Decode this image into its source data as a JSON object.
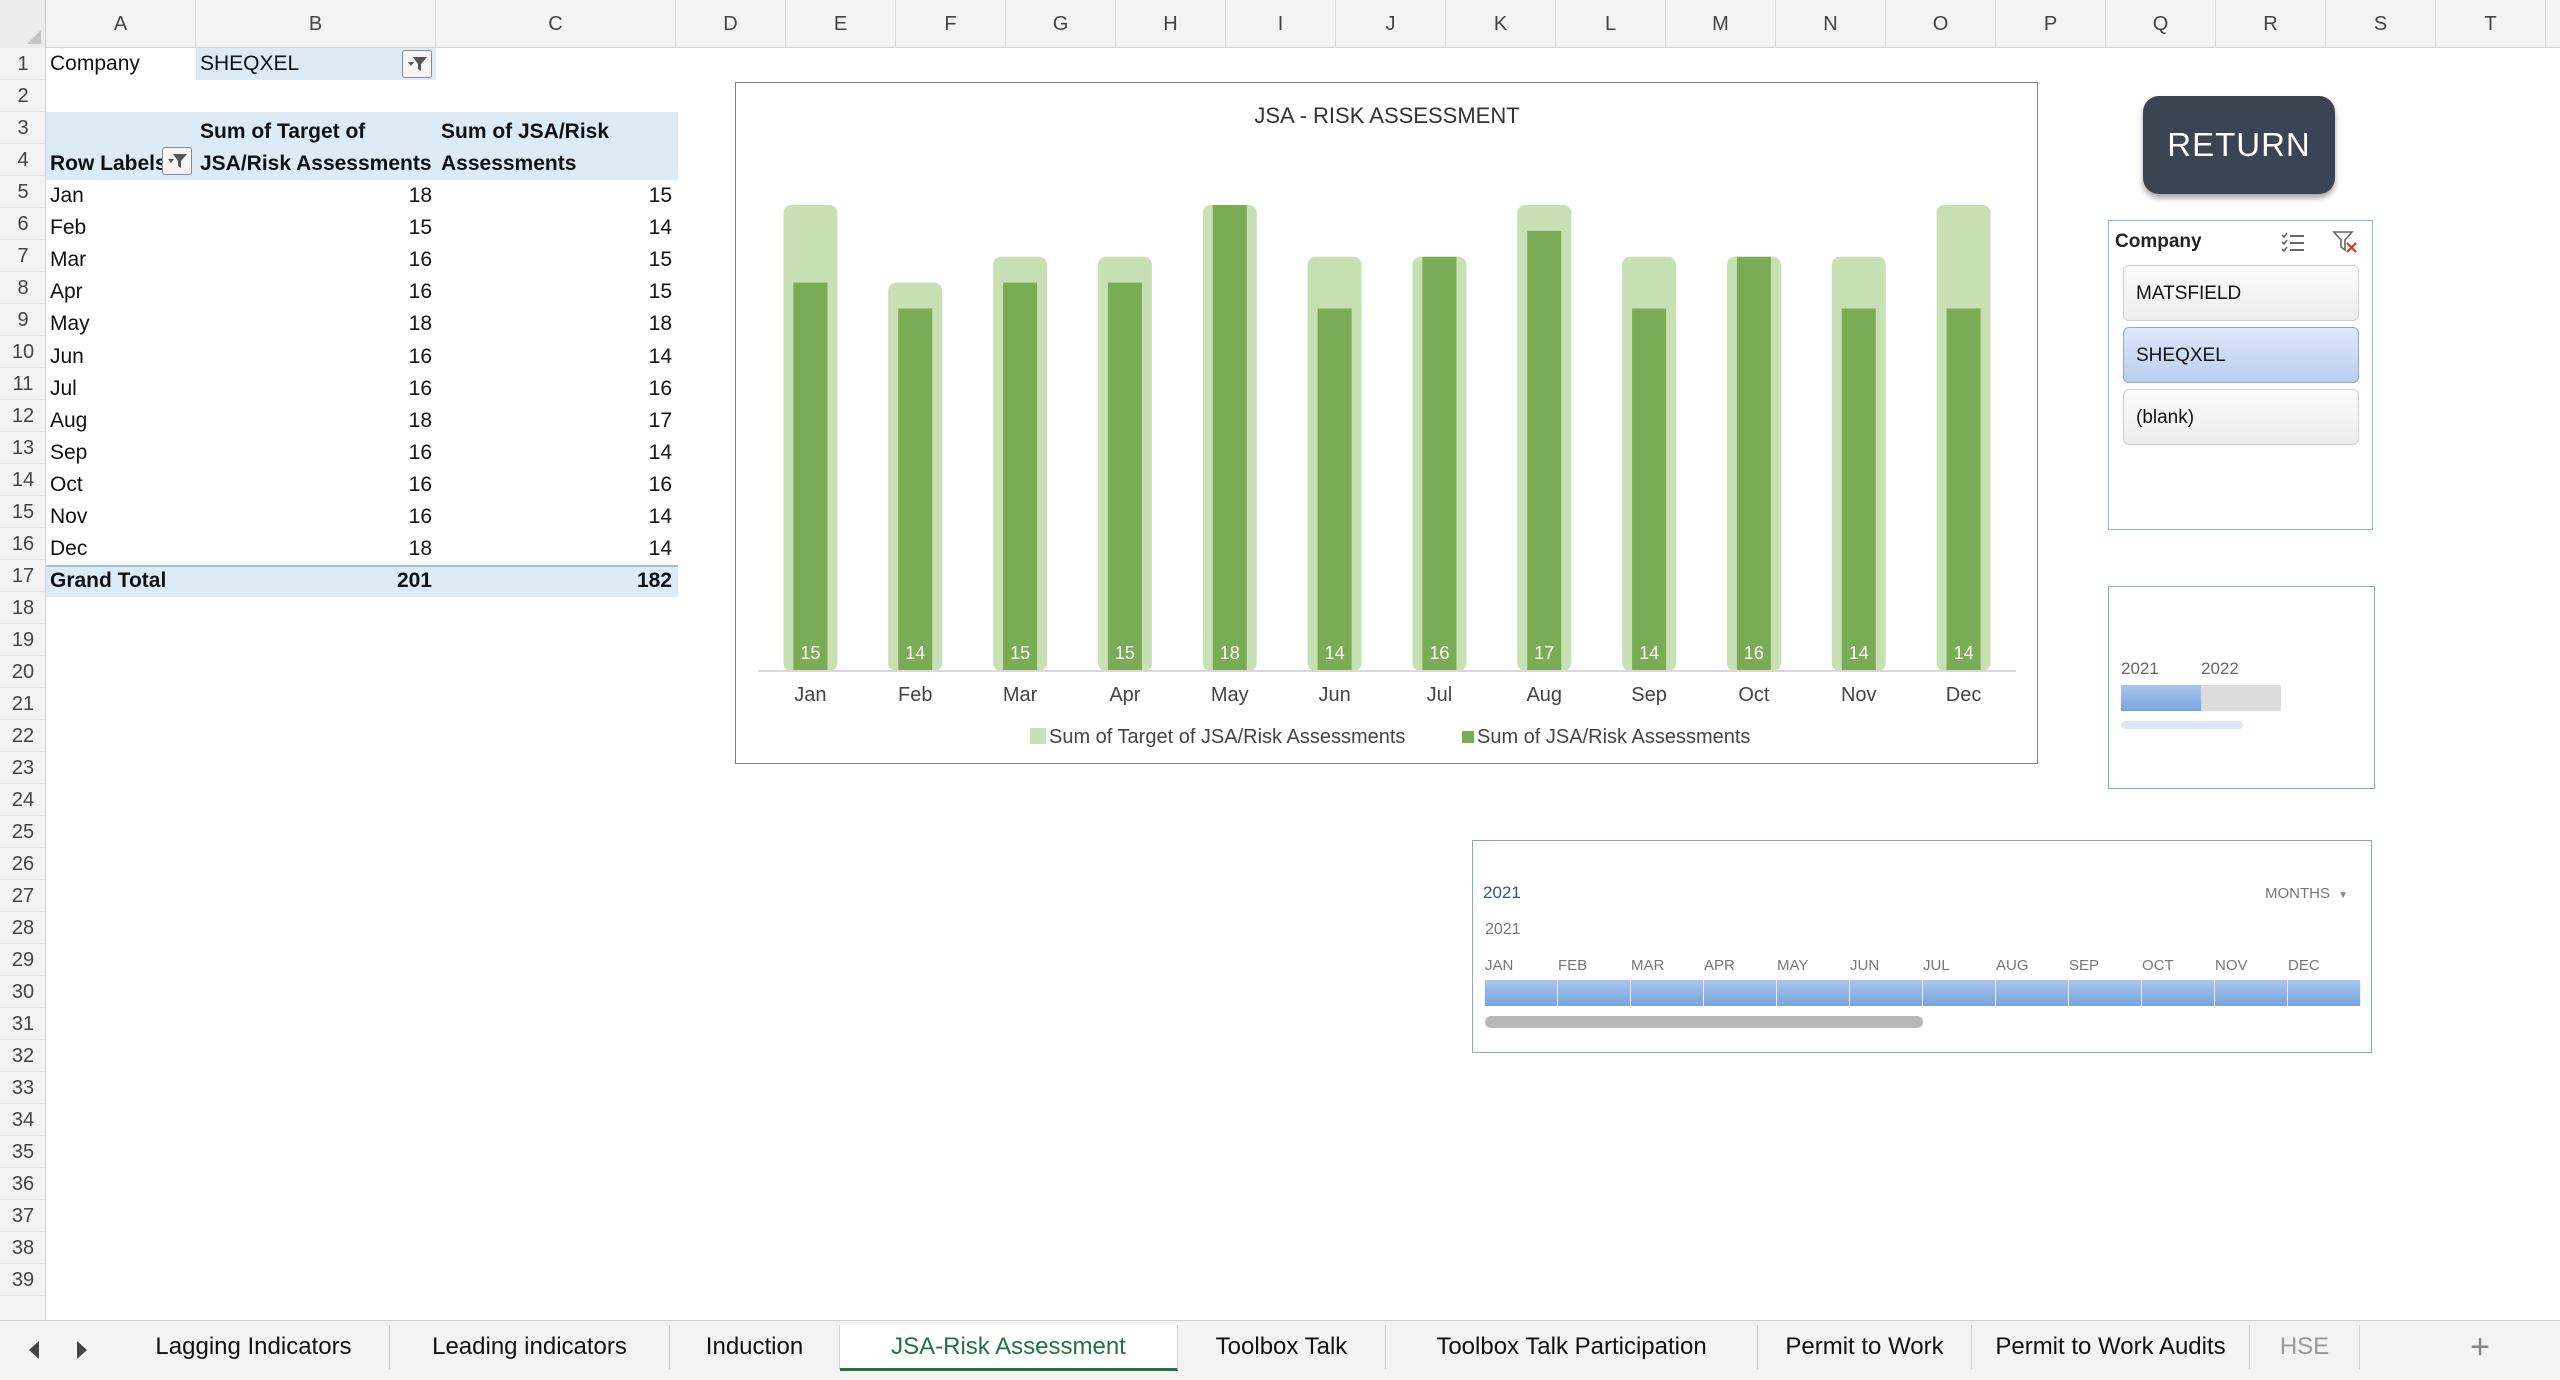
{
  "columns": [
    "A",
    "B",
    "C",
    "D",
    "E",
    "F",
    "G",
    "H",
    "I",
    "J",
    "K",
    "L",
    "M",
    "N",
    "O",
    "P",
    "Q",
    "R",
    "S",
    "T"
  ],
  "rows": [
    "1",
    "2",
    "3",
    "4",
    "5",
    "6",
    "7",
    "8",
    "9",
    "10",
    "11",
    "12",
    "13",
    "14",
    "15",
    "16",
    "17",
    "18",
    "19",
    "20",
    "21",
    "22",
    "23",
    "24",
    "25",
    "26",
    "27",
    "28",
    "29",
    "30",
    "31",
    "32",
    "33",
    "34",
    "35",
    "36",
    "37",
    "38",
    "39"
  ],
  "pivot": {
    "filter_label": "Company",
    "filter_value": "SHEQXEL",
    "row_labels_header": "Row Labels",
    "col_b_header_line1": "Sum of Target of",
    "col_b_header_line2": "JSA/Risk Assessments",
    "col_c_header_line1": "Sum of JSA/Risk",
    "col_c_header_line2": "Assessments",
    "rows": [
      {
        "label": "Jan",
        "target": "18",
        "actual": "15"
      },
      {
        "label": "Feb",
        "target": "15",
        "actual": "14"
      },
      {
        "label": "Mar",
        "target": "16",
        "actual": "15"
      },
      {
        "label": "Apr",
        "target": "16",
        "actual": "15"
      },
      {
        "label": "May",
        "target": "18",
        "actual": "18"
      },
      {
        "label": "Jun",
        "target": "16",
        "actual": "14"
      },
      {
        "label": "Jul",
        "target": "16",
        "actual": "16"
      },
      {
        "label": "Aug",
        "target": "18",
        "actual": "17"
      },
      {
        "label": "Sep",
        "target": "16",
        "actual": "14"
      },
      {
        "label": "Oct",
        "target": "16",
        "actual": "16"
      },
      {
        "label": "Nov",
        "target": "16",
        "actual": "14"
      },
      {
        "label": "Dec",
        "target": "18",
        "actual": "14"
      }
    ],
    "grand_total_label": "Grand Total",
    "grand_total_target": "201",
    "grand_total_actual": "182"
  },
  "chart_data": {
    "type": "bar",
    "title": "JSA - RISK ASSESSMENT",
    "categories": [
      "Jan",
      "Feb",
      "Mar",
      "Apr",
      "May",
      "Jun",
      "Jul",
      "Aug",
      "Sep",
      "Oct",
      "Nov",
      "Dec"
    ],
    "series": [
      {
        "name": "Sum of Target of JSA/Risk Assessments",
        "values": [
          18,
          15,
          16,
          16,
          18,
          16,
          16,
          18,
          16,
          16,
          16,
          18
        ],
        "color": "#c7e0b4"
      },
      {
        "name": "Sum of JSA/Risk Assessments",
        "values": [
          15,
          14,
          15,
          15,
          18,
          14,
          16,
          17,
          14,
          16,
          14,
          14
        ],
        "color": "#7aab55"
      }
    ],
    "ylim": [
      0,
      18
    ],
    "grid": false,
    "legend": "bottom",
    "data_labels": true
  },
  "return_button": {
    "label": "RETURN"
  },
  "company_slicer": {
    "title": "Company",
    "items": [
      "MATSFIELD",
      "SHEQXEL",
      "(blank)"
    ],
    "selected": "SHEQXEL"
  },
  "year_timeline": {
    "years": [
      "2021",
      "2022"
    ],
    "selected": "2021"
  },
  "month_timeline": {
    "selection_label": "2021",
    "level_label": "MONTHS",
    "year_label": "2021",
    "months": [
      "JAN",
      "FEB",
      "MAR",
      "APR",
      "MAY",
      "JUN",
      "JUL",
      "AUG",
      "SEP",
      "OCT",
      "NOV",
      "DEC"
    ]
  },
  "tabs": [
    "Lagging Indicators",
    "Leading indicators",
    "Induction",
    "JSA-Risk Assessment",
    "Toolbox Talk",
    "Toolbox Talk Participation",
    "Permit to Work",
    "Permit to Work Audits",
    "HSE"
  ],
  "active_tab": "JSA-Risk Assessment",
  "colors": {
    "accent": "#217346",
    "pivot_band": "#ddebf7",
    "return_bg": "#3b4453"
  }
}
